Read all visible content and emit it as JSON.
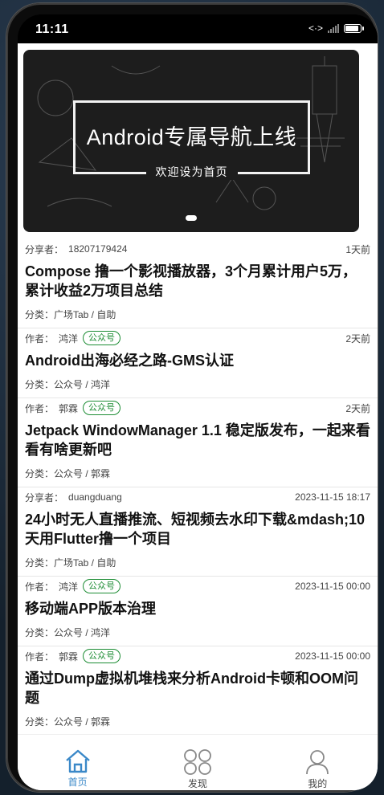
{
  "status": {
    "time": "11:11"
  },
  "banner": {
    "title": "Android专属导航上线",
    "subtitle": "欢迎设为首页"
  },
  "articles": [
    {
      "author_label": "分享者：",
      "author": "18207179424",
      "badge": "",
      "date": "1天前",
      "title": "Compose 撸一个影视播放器，3个月累计用户5万，累计收益2万项目总结",
      "category": "分类：广场Tab / 自助"
    },
    {
      "author_label": "作者：",
      "author": "鸿洋",
      "badge": "公众号",
      "date": "2天前",
      "title": "Android出海必经之路-GMS认证",
      "category": "分类：公众号 / 鸿洋"
    },
    {
      "author_label": "作者：",
      "author": "郭霖",
      "badge": "公众号",
      "date": "2天前",
      "title": "Jetpack WindowManager 1.1 稳定版发布，一起来看看有啥更新吧",
      "category": "分类：公众号 / 郭霖"
    },
    {
      "author_label": "分享者：",
      "author": "duangduang",
      "badge": "",
      "date": "2023-11-15 18:17",
      "title": "24小时无人直播推流、短视频去水印下载&mdash;10天用Flutter撸一个项目",
      "category": "分类：广场Tab / 自助"
    },
    {
      "author_label": "作者：",
      "author": "鸿洋",
      "badge": "公众号",
      "date": "2023-11-15 00:00",
      "title": "移动端APP版本治理",
      "category": "分类：公众号 / 鸿洋"
    },
    {
      "author_label": "作者：",
      "author": "郭霖",
      "badge": "公众号",
      "date": "2023-11-15 00:00",
      "title": "通过Dump虚拟机堆栈来分析Android卡顿和OOM问题",
      "category": "分类：公众号 / 郭霖"
    }
  ],
  "tabs": [
    {
      "label": "首页",
      "icon": "home-icon",
      "active": true
    },
    {
      "label": "发现",
      "icon": "discover-icon",
      "active": false
    },
    {
      "label": "我的",
      "icon": "profile-icon",
      "active": false
    }
  ],
  "colors": {
    "accent": "#3a88c8",
    "badge": "#1d8d34"
  }
}
